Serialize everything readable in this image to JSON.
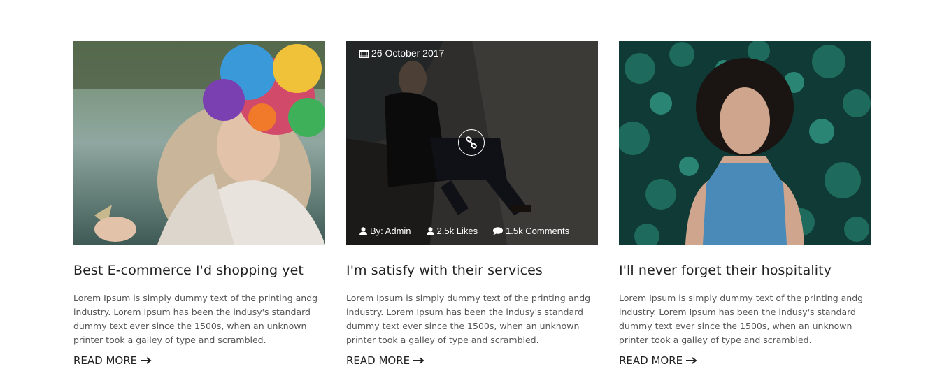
{
  "posts": [
    {
      "title": "Best E-commerce I'd shopping yet",
      "excerpt": "Lorem Ipsum is simply dummy text of the printing andg industry. Lorem Ipsum has been the indusy's standard dummy text ever since the 1500s, when an unknown printer took a galley of type and scrambled.",
      "read_more": "READ MORE"
    },
    {
      "title": "I'm satisfy with their services",
      "excerpt": "Lorem Ipsum is simply dummy text of the printing andg industry. Lorem Ipsum has been the indusy's standard dummy text ever since the 1500s, when an unknown printer took a galley of type and scrambled.",
      "read_more": "READ MORE",
      "date": "26 October 2017",
      "author": "By: Admin",
      "likes": "2.5k Likes",
      "comments": "1.5k Comments"
    },
    {
      "title": "I'll never forget their hospitality",
      "excerpt": "Lorem Ipsum is simply dummy text of the printing andg industry. Lorem Ipsum has been the indusy's standard dummy text ever since the 1500s, when an unknown printer took a galley of type and scrambled.",
      "read_more": "READ MORE"
    }
  ],
  "icons": {
    "date": "calendar-icon",
    "author": "user-icon",
    "likes": "user-icon",
    "comments": "comment-icon",
    "link": "link-icon",
    "read_more": "arrow-right-icon"
  }
}
